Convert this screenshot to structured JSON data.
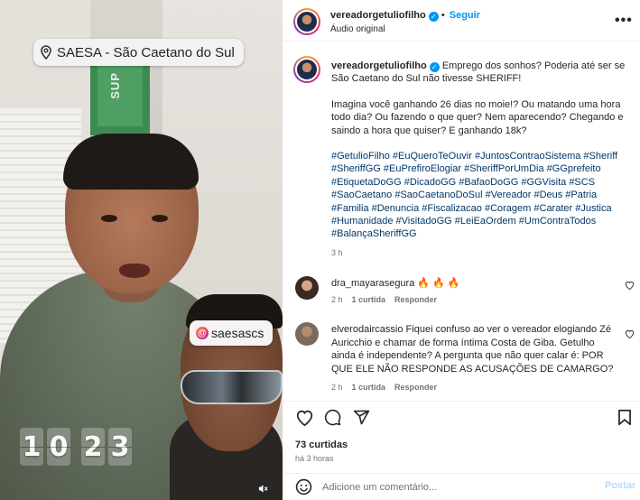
{
  "media": {
    "location_sticker": "SAESA - São Caetano do Sul",
    "mention_sticker": "saesascs",
    "background_sign_text": "SUP",
    "clock_digits": [
      "1",
      "0",
      "2",
      "3"
    ]
  },
  "post_header": {
    "username": "vereadorgetuliofilho",
    "follow_label": "Seguir",
    "audio_label": "Áudio original",
    "more_glyph": "•••"
  },
  "caption": {
    "username": "vereadorgetuliofilho",
    "text_1": "Emprego dos sonhos? Poderia até ser se São Caetano do Sul não tivesse SHERIFF!",
    "text_2": "Imagina você ganhando 26 dias no moie!? Ou matando uma hora todo dia? Ou fazendo o que quer? Nem aparecendo? Chegando e saindo a hora que quiser? E ganhando 18k?",
    "hashtags": "#GetulioFilho #EuQueroTeOuvir #JuntosContraoSistema #Sheriff #SheriffGG #EuPrefiroElogiar #SheriffPorUmDia #GGprefeito #EtiquetaDoGG #DicadoGG #BafaoDoGG #GGVisita #SCS #SaoCaetano #SaoCaetanoDoSul #Vereador #Deus #Patria #Familia #Denuncia #Fiscalizacao #Coragem #Carater #Justica #Humanidade #VisitadoGG #LeiEaOrdem #UmContraTodos #BalançaSheriffGG",
    "time": "3 h"
  },
  "comments": [
    {
      "username": "dra_mayarasegura",
      "text": "🔥 🔥 🔥",
      "time": "2 h",
      "likes": "1 curtida",
      "reply_label": "Responder"
    },
    {
      "username": "elverodaircassio",
      "text": "Fiquei confuso ao ver o vereador elogiando Zé Auricchio e chamar de forma íntima Costa de Giba. Getulho ainda é independente? A pergunta que não quer calar é: POR QUE ELE NÃO RESPONDE AS ACUSAÇÕES DE CAMARGO?",
      "time": "2 h",
      "likes": "1 curtida",
      "reply_label": "Responder"
    }
  ],
  "actions": {
    "likes_count": "73 curtidas",
    "posted_ago": "há 3 horas"
  },
  "comment_bar": {
    "placeholder": "Adicione um comentário...",
    "post_label": "Postar"
  },
  "colors": {
    "link_blue": "#0095f6",
    "hashtag_blue": "#00376b",
    "sign_green": "#3d8a53"
  },
  "icons": [
    "location-pin-icon",
    "mention-at-icon",
    "mute-icon",
    "verified-badge-icon",
    "more-options-icon",
    "heart-icon",
    "comment-icon",
    "share-icon",
    "bookmark-icon",
    "emoji-icon"
  ]
}
